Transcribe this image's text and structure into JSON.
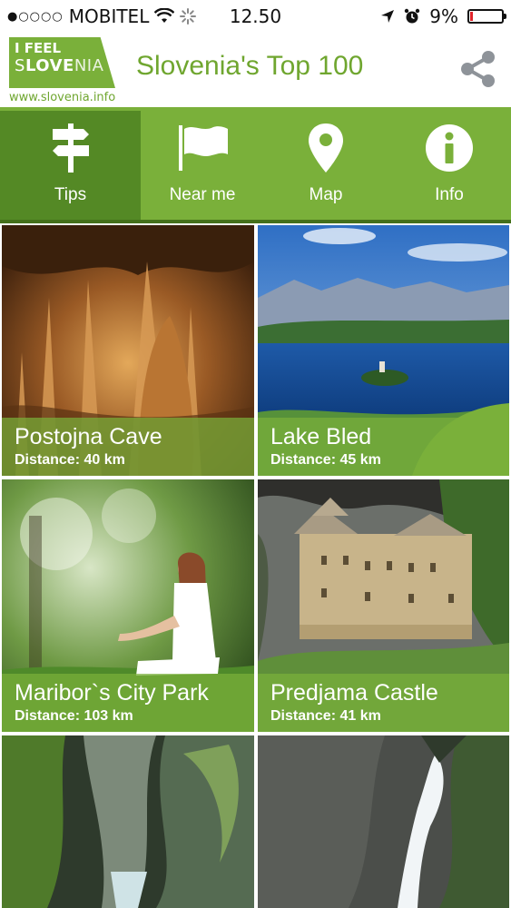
{
  "status_bar": {
    "carrier": "MOBITEL",
    "time": "12.50",
    "battery": "9%",
    "battery_level": 0.09,
    "icons": [
      "signal-dots-icon",
      "wifi-icon",
      "activity-spinner-icon",
      "location-arrow-icon",
      "alarm-icon",
      "battery-icon"
    ]
  },
  "header": {
    "logo_line1": "I FEEL",
    "logo_line2_a": "S",
    "logo_line2_b": "LOVE",
    "logo_line2_c": "NIA",
    "logo_url": "www.slovenia.info",
    "title": "Slovenia's Top 100",
    "share_icon": "share-icon"
  },
  "tabs": [
    {
      "label": "Tips",
      "icon": "signpost-icon",
      "active": true
    },
    {
      "label": "Near me",
      "icon": "flag-icon",
      "active": false
    },
    {
      "label": "Map",
      "icon": "map-pin-icon",
      "active": false
    },
    {
      "label": "Info",
      "icon": "info-icon",
      "active": false
    }
  ],
  "places": [
    {
      "name": "Postojna Cave",
      "distance": "Distance: 40 km"
    },
    {
      "name": "Lake Bled",
      "distance": "Distance: 45 km"
    },
    {
      "name": "Maribor`s City Park",
      "distance": "Distance: 103 km"
    },
    {
      "name": "Predjama Castle",
      "distance": "Distance: 41 km"
    },
    {
      "name": "",
      "distance": ""
    },
    {
      "name": "",
      "distance": ""
    }
  ],
  "colors": {
    "brand_green": "#7ab03a",
    "active_tab": "#548925",
    "battery_low": "#e0242a"
  }
}
